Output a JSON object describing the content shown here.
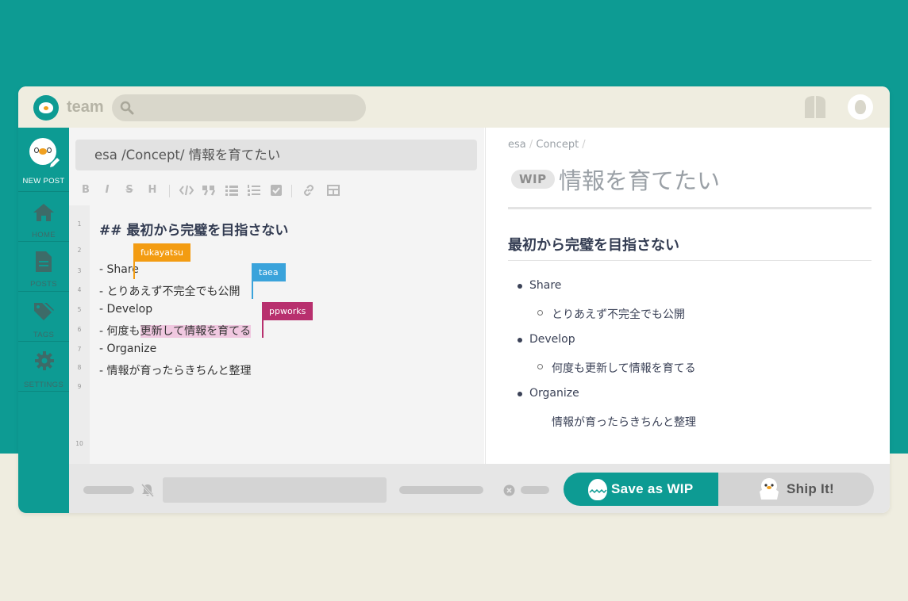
{
  "header": {
    "team": "team",
    "search_placeholder": ""
  },
  "sidebar": {
    "items": [
      {
        "label": "NEW POST",
        "icon": "new-post-avatar-icon"
      },
      {
        "label": "HOME",
        "icon": "home-icon"
      },
      {
        "label": "POSTS",
        "icon": "document-icon"
      },
      {
        "label": "TAGS",
        "icon": "tags-icon"
      },
      {
        "label": "SETTINGS",
        "icon": "gear-icon"
      }
    ]
  },
  "editor": {
    "title": "esa /Concept/ 情報を育てたい",
    "toolbar": [
      "B",
      "I",
      "S",
      "H"
    ],
    "line_numbers": [
      "1",
      "2",
      "3",
      "4",
      "5",
      "6",
      "7",
      "8",
      "9",
      "10"
    ],
    "lines": {
      "l1": "## 最初から完璧を目指さない",
      "l3": "- Share",
      "l4": "  - とりあえず不完全でも公開",
      "l5": "- Develop",
      "l6_pre": "  - 何度も",
      "l6_hl": "更新して情報を育てる",
      "l7": "- Organize",
      "l8": "  - 情報が育ったらきちんと整理"
    },
    "collaborators": [
      {
        "name": "fukayatsu",
        "color": "#f39c12"
      },
      {
        "name": "taea",
        "color": "#3aa3db"
      },
      {
        "name": "ppworks",
        "color": "#b8306e"
      }
    ]
  },
  "preview": {
    "breadcrumb": [
      "esa",
      "Concept"
    ],
    "wip": "WIP",
    "title": "情報を育てたい",
    "heading": "最初から完璧を目指さない",
    "items": [
      {
        "label": "Share",
        "sub": "とりあえず不完全でも公開"
      },
      {
        "label": "Develop",
        "sub": "何度も更新して情報を育てる"
      },
      {
        "label": "Organize",
        "sub": "情報が育ったらきちんと整理"
      }
    ]
  },
  "footer": {
    "save_wip": "Save as WIP",
    "ship_it": "Ship It!"
  },
  "colors": {
    "brand": "#0d9b93",
    "cream": "#efede0"
  }
}
